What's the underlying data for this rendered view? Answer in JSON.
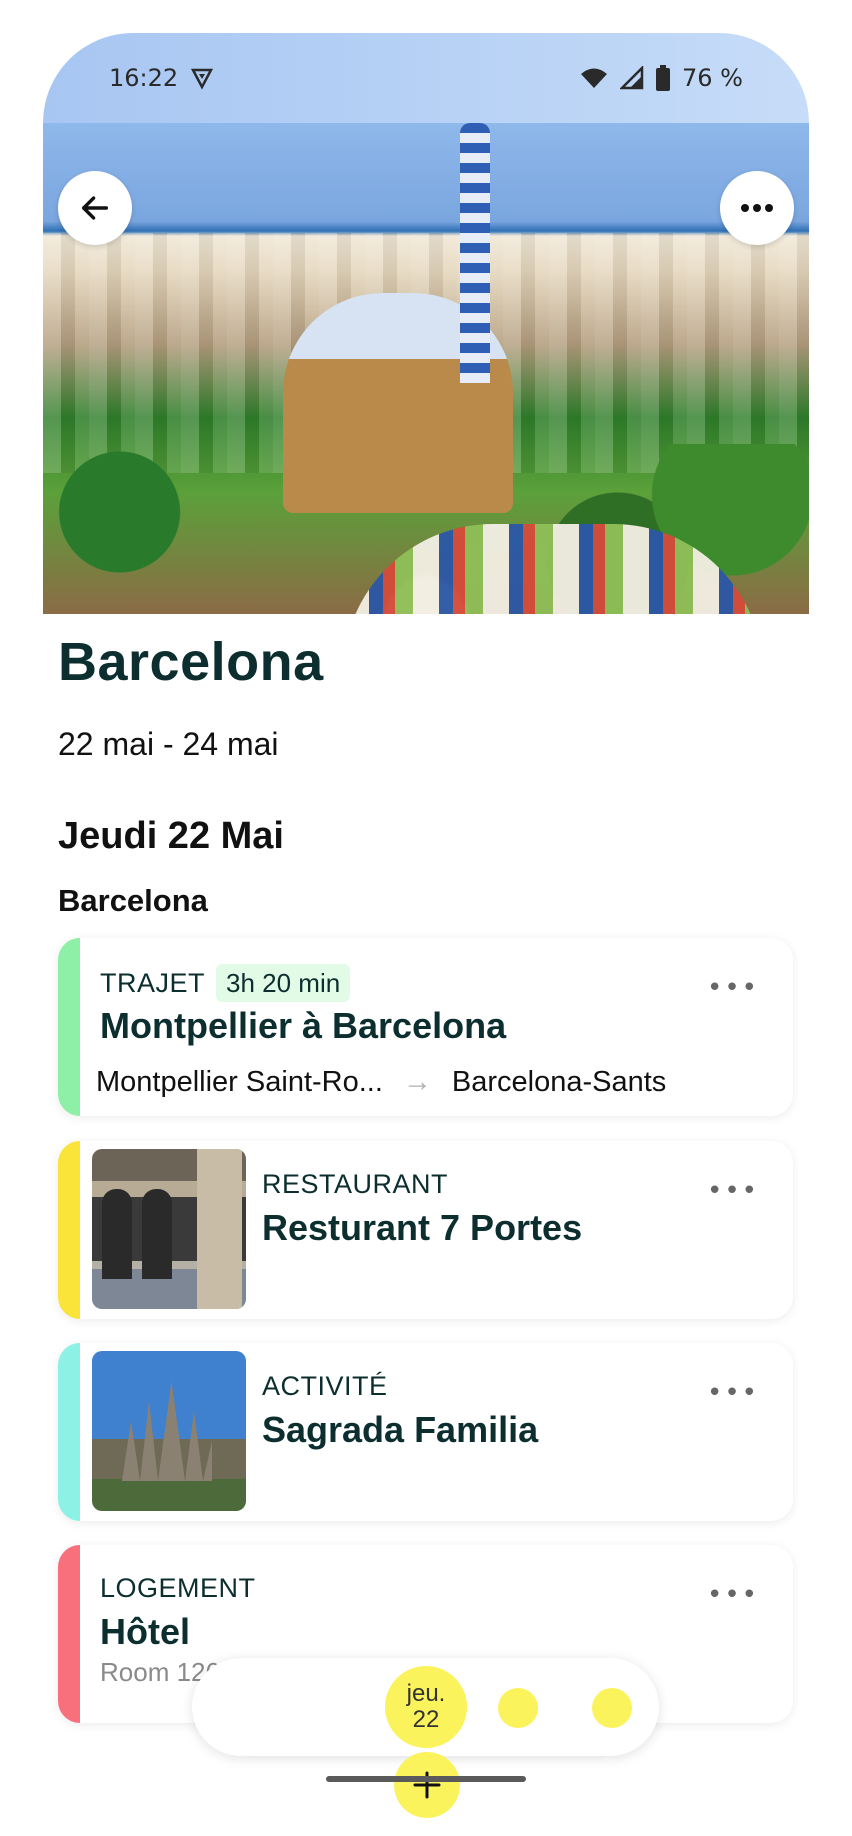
{
  "status": {
    "time": "16:22",
    "battery": "76 %"
  },
  "trip": {
    "title": "Barcelona",
    "dates": "22 mai - 24 mai"
  },
  "day": {
    "title": "Jeudi 22 Mai",
    "place": "Barcelona"
  },
  "cards": [
    {
      "type": "TRAJET",
      "duration": "3h 20 min",
      "name": "Montpellier à Barcelona",
      "from": "Montpellier Saint-Ro...",
      "to": "Barcelona-Sants",
      "accent": "#8ef0a6"
    },
    {
      "type": "RESTAURANT",
      "name": "Resturant 7 Portes",
      "accent": "#fbe43a"
    },
    {
      "type": "ACTIVITÉ",
      "name": "Sagrada Familia",
      "accent": "#8df1e5"
    },
    {
      "type": "LOGEMENT",
      "name": "Hôtel",
      "detail": "Room 126",
      "accent": "#f8707c"
    }
  ],
  "day_picker": {
    "day_abbr": "jeu.",
    "day_num": "22"
  },
  "icons": {
    "back": "arrow-left-icon",
    "more": "more-horizontal-icon",
    "add": "plus-icon",
    "vpn": "vpn-shield-icon",
    "wifi": "wifi-icon",
    "signal": "signal-icon",
    "battery": "battery-icon"
  }
}
